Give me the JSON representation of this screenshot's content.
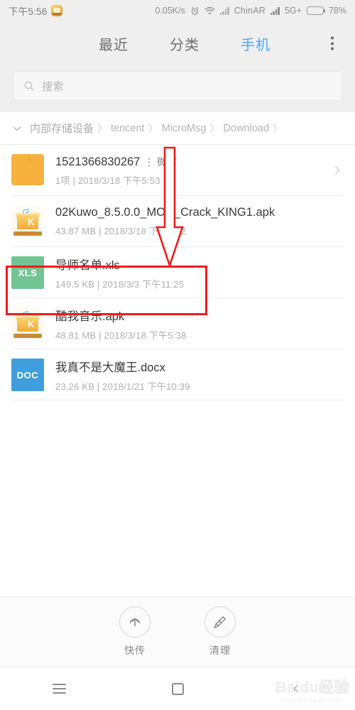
{
  "statusbar": {
    "time": "下午5:56",
    "app_icon": "kuwo-app-icon",
    "network_speed": "0.05K/s",
    "alarm_icon": "alarm-icon",
    "wifi_icon": "wifi-icon",
    "signal_icon": "signal-bars-icon",
    "carrier": "ChinAR",
    "signal2_icon": "signal-bars-icon",
    "network_type": "5G+",
    "battery_icon": "battery-icon",
    "battery_level": "78%",
    "battery_percent": 78
  },
  "tabbar": {
    "tabs": [
      {
        "label": "最近",
        "active": false
      },
      {
        "label": "分类",
        "active": false
      },
      {
        "label": "手机",
        "active": true
      }
    ],
    "overflow_icon": "more-vertical-icon",
    "active_color": "#4fa8f5",
    "inactive_color": "#6e6e6e"
  },
  "search": {
    "icon": "search-icon",
    "placeholder": "搜索",
    "value": ""
  },
  "breadcrumb": {
    "collapse_icon": "chevron-down-icon",
    "segments": [
      "内部存储设备",
      "tencent",
      "MicroMsg",
      "Download"
    ],
    "separator": "〉"
  },
  "files": [
    {
      "icon_type": "folder",
      "icon_color": "#f6b13f",
      "name": "1521366830267",
      "badge": "微信",
      "meta": "1项 | 2018/3/18 下午5:53",
      "has_chevron": true,
      "highlighted": false
    },
    {
      "icon_type": "apk",
      "icon_color": "#f4ab33",
      "name": "02Kuwo_8.5.0.0_MOD_Crack_KING1.apk",
      "badge": "",
      "meta": "43.87 MB | 2018/3/18 下午5:22",
      "has_chevron": false,
      "highlighted": false
    },
    {
      "icon_type": "xls",
      "icon_label": "XLS",
      "icon_color": "#72c493",
      "name": "导师名单.xls",
      "badge": "",
      "meta": "149.5 KB | 2018/3/3 下午11:25",
      "has_chevron": false,
      "highlighted": true
    },
    {
      "icon_type": "apk",
      "icon_color": "#f4ab33",
      "name": "酷我音乐.apk",
      "badge": "",
      "meta": "48.81 MB | 2018/3/18 下午5:38",
      "has_chevron": false,
      "highlighted": false
    },
    {
      "icon_type": "doc",
      "icon_label": "DOC",
      "icon_color": "#3e9fdc",
      "name": "我真不是大魔王.docx",
      "badge": "",
      "meta": "23.26 KB | 2018/1/21 下午10:39",
      "has_chevron": false,
      "highlighted": false
    }
  ],
  "annotations": {
    "arrow_color": "#ef1c18",
    "box_color": "#ef1c18",
    "arrow_direction": "down"
  },
  "actionbar": {
    "actions": [
      {
        "label": "快传",
        "icon": "upload-circle-icon"
      },
      {
        "label": "清理",
        "icon": "broom-icon"
      }
    ]
  },
  "navbar": {
    "buttons": [
      {
        "icon": "menu-icon"
      },
      {
        "icon": "home-square-icon"
      },
      {
        "icon": "back-chevron-icon"
      }
    ]
  },
  "watermark": {
    "main": "Baidu经验",
    "sub": "jingyan.baidu.com"
  }
}
